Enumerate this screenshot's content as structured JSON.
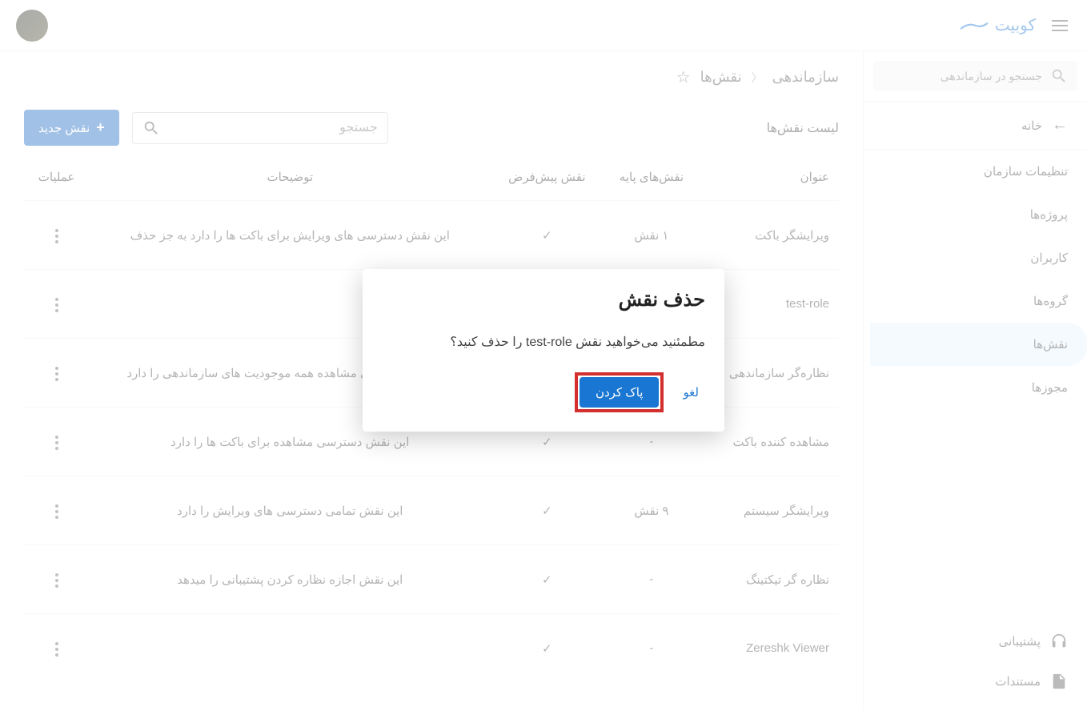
{
  "header": {
    "brand": "کوبیت"
  },
  "sidebar": {
    "search_placeholder": "جستجو در سازماندهی",
    "home": "خانه",
    "items": [
      "تنظیمات سازمان",
      "پروژه‌ها",
      "کاربران",
      "گروه‌ها",
      "نقش‌ها",
      "مجوزها"
    ],
    "footer": {
      "support": "پشتیبانی",
      "docs": "مستندات"
    }
  },
  "breadcrumb": {
    "root": "سازماندهی",
    "current": "نقش‌ها"
  },
  "toolbar": {
    "title": "لیست نقش‌ها",
    "search_placeholder": "جستجو",
    "new_btn": "نقش جدید"
  },
  "table": {
    "headers": {
      "title": "عنوان",
      "base_roles": "نقش‌های پایه",
      "default_role": "نقش پیش‌فرض",
      "description": "توضیحات",
      "actions": "عملیات"
    },
    "rows": [
      {
        "title": "ویرایشگر باکت",
        "base": "۱ نقش",
        "default": "✓",
        "desc": "این نقش دسترسی های ویرایش برای باکت ها را دارد به جز حذف"
      },
      {
        "title": "test-role",
        "base": "-",
        "default": "",
        "desc": ""
      },
      {
        "title": "نظاره‌گر سازماندهی",
        "base": "-",
        "default": "✓",
        "desc": "این نقش دسترسی مشاهده همه موجودیت های سازماندهی را دارد"
      },
      {
        "title": "مشاهده کننده باکت",
        "base": "-",
        "default": "✓",
        "desc": "این نقش دسترسی مشاهده برای باکت ها را دارد"
      },
      {
        "title": "ویرایشگر سیستم",
        "base": "۹ نقش",
        "default": "✓",
        "desc": "این نقش تمامی دسترسی های ویرایش را دارد"
      },
      {
        "title": "نظاره گر تیکتینگ",
        "base": "-",
        "default": "✓",
        "desc": "این نقش اجازه نظاره کردن پشتیبانی را میدهد"
      },
      {
        "title": "Zereshk Viewer",
        "base": "-",
        "default": "✓",
        "desc": ""
      }
    ]
  },
  "dialog": {
    "title": "حذف نقش",
    "text": "مطمئنید می‌خواهید نقش test-role را حذف کنید؟",
    "cancel": "لغو",
    "confirm": "پاک کردن"
  }
}
